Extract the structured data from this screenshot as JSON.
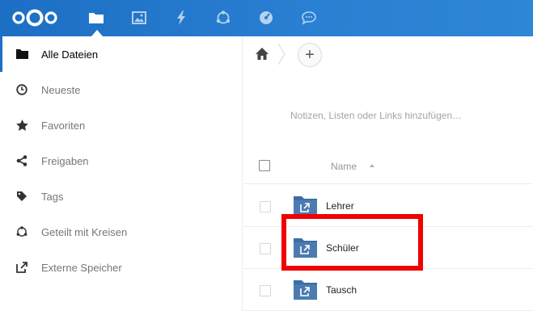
{
  "header": {
    "apps": [
      {
        "name": "files",
        "active": true
      },
      {
        "name": "photos",
        "active": false
      },
      {
        "name": "activity",
        "active": false
      },
      {
        "name": "circles",
        "active": false
      },
      {
        "name": "dashboard",
        "active": false
      },
      {
        "name": "talk",
        "active": false
      }
    ],
    "accent_color": "#1c6fc4"
  },
  "sidebar": {
    "items": [
      {
        "label": "Alle Dateien",
        "icon": "folder-icon",
        "active": true
      },
      {
        "label": "Neueste",
        "icon": "clock-icon",
        "active": false
      },
      {
        "label": "Favoriten",
        "icon": "star-icon",
        "active": false
      },
      {
        "label": "Freigaben",
        "icon": "share-icon",
        "active": false
      },
      {
        "label": "Tags",
        "icon": "tag-icon",
        "active": false
      },
      {
        "label": "Geteilt mit Kreisen",
        "icon": "circles-icon",
        "active": false
      },
      {
        "label": "Externe Speicher",
        "icon": "external-link-icon",
        "active": false
      }
    ]
  },
  "main": {
    "add_label": "+",
    "notes_placeholder": "Notizen, Listen oder Links hinzufügen…",
    "column_name": "Name",
    "files": [
      {
        "name": "Lehrer",
        "type": "external-folder"
      },
      {
        "name": "Schüler",
        "type": "external-folder"
      },
      {
        "name": "Tausch",
        "type": "external-folder"
      }
    ]
  },
  "annotation": {
    "highlight_color": "#f00000",
    "highlighted_file": "Schüler"
  }
}
